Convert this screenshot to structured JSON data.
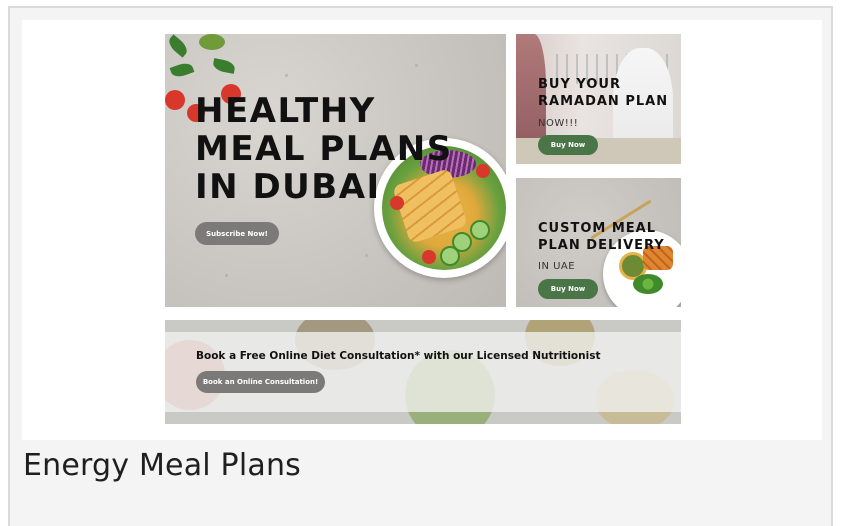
{
  "caption": "Energy Meal Plans",
  "hero": {
    "title_lines": [
      "HEALTHY",
      "MEAL PLANS",
      "IN DUBAI"
    ],
    "cta": "Subscribe Now!"
  },
  "ramadan": {
    "title_lines": [
      "BUY YOUR",
      "RAMADAN PLAN"
    ],
    "subtitle": "NOW!!!",
    "cta": "Buy Now"
  },
  "custom": {
    "title_lines": [
      "CUSTOM MEAL",
      "PLAN DELIVERY"
    ],
    "subtitle": "IN UAE",
    "cta": "Buy Now"
  },
  "banner": {
    "text": "Book a Free Online Diet Consultation* with our Licensed Nutritionist",
    "cta": "Book an Online Consultation!"
  },
  "colors": {
    "grey_button": "#7c7a79",
    "green_button": "#4a7547"
  }
}
